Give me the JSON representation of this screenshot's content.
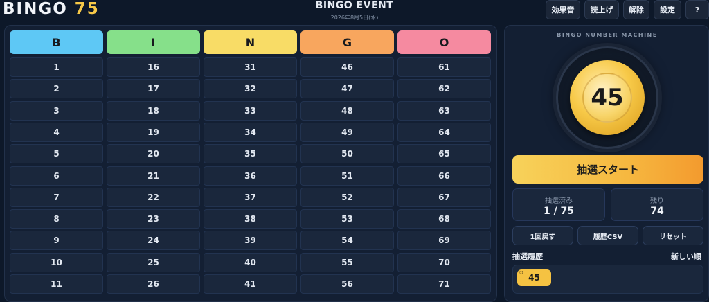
{
  "header": {
    "logo_text": "BINGO",
    "logo_number": "75",
    "event_title": "BINGO EVENT",
    "event_date": "2026年8月5日(水)",
    "buttons": [
      {
        "label": "効果音",
        "active": true
      },
      {
        "label": "読上げ",
        "active": true
      },
      {
        "label": "解除",
        "active": false
      },
      {
        "label": "設定",
        "active": false
      },
      {
        "label": "?",
        "active": false
      }
    ]
  },
  "board": {
    "columns": [
      {
        "letter": "B",
        "color": "#5ec8f5",
        "numbers": [
          "1",
          "2",
          "3",
          "4",
          "5",
          "6",
          "7",
          "8",
          "9",
          "10",
          "11"
        ]
      },
      {
        "letter": "I",
        "color": "#86e08a",
        "numbers": [
          "16",
          "17",
          "18",
          "19",
          "20",
          "21",
          "22",
          "23",
          "24",
          "25",
          "26"
        ]
      },
      {
        "letter": "N",
        "color": "#f8dc66",
        "numbers": [
          "31",
          "32",
          "33",
          "34",
          "35",
          "36",
          "37",
          "38",
          "39",
          "40",
          "41"
        ]
      },
      {
        "letter": "G",
        "color": "#f8a65e",
        "numbers": [
          "46",
          "47",
          "48",
          "49",
          "50",
          "51",
          "52",
          "53",
          "54",
          "55",
          "56"
        ]
      },
      {
        "letter": "O",
        "color": "#f58aa0",
        "numbers": [
          "61",
          "62",
          "63",
          "64",
          "65",
          "66",
          "67",
          "68",
          "69",
          "70",
          "71"
        ]
      }
    ]
  },
  "machine": {
    "label": "BINGO NUMBER MACHINE",
    "current_number": "45",
    "start_label": "抽選スタート",
    "drawn_label": "抽選済み",
    "drawn_value": "1 / 75",
    "remaining_label": "残り",
    "remaining_value": "74",
    "undo_label": "1回戻す",
    "csv_label": "履歴CSV",
    "reset_label": "リセット",
    "history_title": "抽選履歴",
    "history_order": "新しい順",
    "history": [
      {
        "index": "01",
        "number": "45"
      }
    ]
  }
}
